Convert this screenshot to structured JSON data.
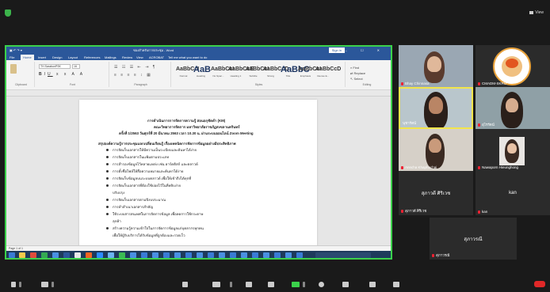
{
  "window": {
    "title": "ชองสำหรับการประชุม - Word",
    "signin": "Sign in"
  },
  "view_label": "View",
  "word": {
    "tabs": [
      "File",
      "Home",
      "Insert",
      "Design",
      "Layout",
      "References",
      "Mailings",
      "Review",
      "View",
      "ACROBAT",
      "Tell me what you want to do"
    ],
    "groups": [
      "Clipboard",
      "Font",
      "Paragraph",
      "Styles",
      "Editing"
    ],
    "styles": [
      {
        "big": "AaBbCcI",
        "name": "Normal"
      },
      {
        "big": "AaB",
        "name": "Heading"
      },
      {
        "big": "AaBbCcI",
        "name": "No Spac..."
      },
      {
        "big": "AaBbCcE",
        "name": "Heading 1"
      },
      {
        "big": "AaBbCcI",
        "name": "Subtitle"
      },
      {
        "big": "AaBbCcD",
        "name": "Strong"
      },
      {
        "big": "AaBbC",
        "name": "Title"
      },
      {
        "big": "AaBbCcI",
        "name": "Emphasis"
      },
      {
        "big": "AaBbCcD",
        "name": "Intense E..."
      }
    ],
    "font_name": "TH SarabunPSK",
    "font_size": "16",
    "status": "Page 1 of 1",
    "lines": [
      "การดำเนินการการจัดการความรู้ สอนอกุชัดดำ (KM)",
      "คณะวิทยาการจัดการ มหาวิทยาลัยราชภัฏสงขลานครินทร์",
      "ครั้งที่ 1/2563 วันศุกร์ที่ 20 มีนาคม 2563 เวลา 10.30 น. ผ่านระบบออนไลน์ Zoom Meeting",
      "สรุปองค์ความรู้การประชุมแลกเปลี่ยนเรียนรู้ เรื่องเทคนิคการจัดการข้อมูลอย่างมีประสิทธิภาพ",
      "การจัดเก็บเอกสารให้มีความเป็นระเบียบและค้นหาได้ง่าย",
      "การจัดเก็บเอกสารในแฟ้มตามประเภท",
      "การสำรองข้อมูลไว้หลายแหล่ง เช่น ฮาร์ดดิสก์ และคลาวด์",
      "การตั้งชื่อไฟล์ให้สื่อความหมายและค้นหาได้ง่าย",
      "การจัดเก็บข้อมูลบนระบบคลาวด์ เพื่อให้เข้าถึงได้ทุกที่",
      "การจัดเก็บเอกสารที่ต้องใช้บ่อยไว้ในที่หยิบง่าย",
      "ปรับปรุง",
      "การจัดเก็บเอกสารตามปีงบประมาณ",
      "การทำสำเนาเอกสารสำคัญ",
      "ใช้ระบบสารสนเทศในการจัดการข้อมูล เพื่อลดการใช้กระดาษ",
      "ลุกค้า",
      "สร้างความรู้ความเข้าใจในการจัดการข้อมูลแก่บุคลากรทุกคน",
      "เพื่อให้ผู้รับบริการได้รับข้อมูลที่ถูกต้องและรวดเร็ว"
    ]
  },
  "participants": [
    {
      "name": "Bhay Chinnasa",
      "kind": "video"
    },
    {
      "name": "CMADM-SKRU",
      "kind": "logo"
    },
    {
      "name": "นุชารัตน์",
      "kind": "video-active"
    },
    {
      "name": "อุไรรัตน์",
      "kind": "video"
    },
    {
      "name": "Anncha Khaphachai",
      "kind": "video"
    },
    {
      "name": "Nawaporn Hieunghong",
      "kind": "video"
    },
    {
      "name": "สุภาวดี ศิริเวช",
      "tile_text": "สุภาวดี ศิริเวช",
      "kind": "name"
    },
    {
      "name": "kan",
      "tile_text": "kan",
      "kind": "name"
    },
    {
      "name": "สุภาวรณี",
      "tile_text": "สุภาวรณี",
      "kind": "name"
    }
  ],
  "colors": {
    "share_border": "#3bd14b",
    "word_blue": "#2b579a",
    "mic_muted": "#e02828",
    "active_speaker": "#f2e54b"
  }
}
